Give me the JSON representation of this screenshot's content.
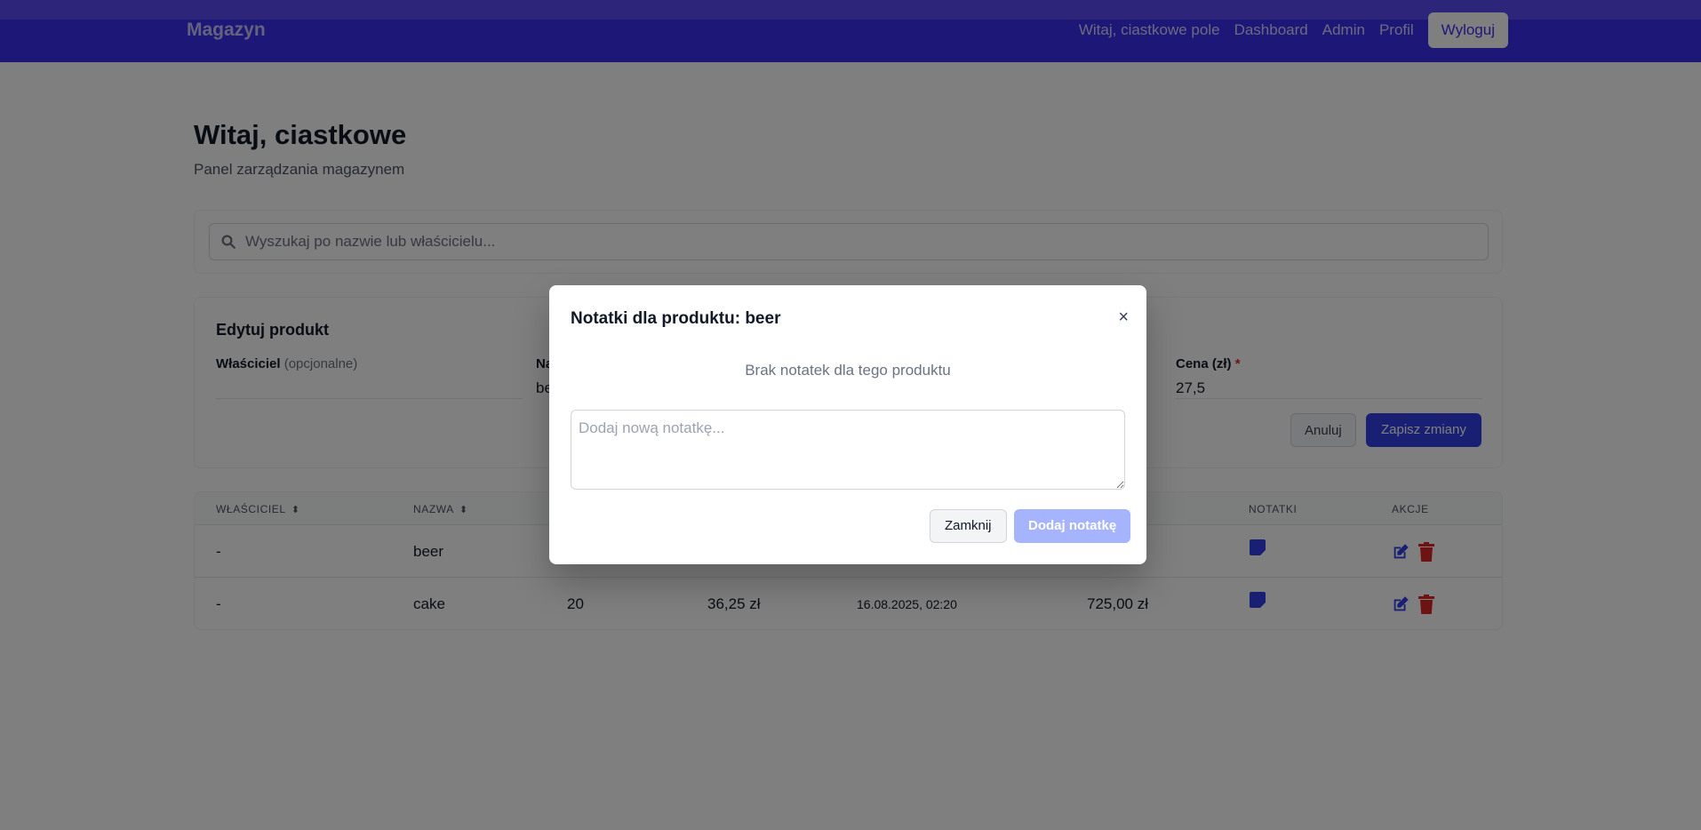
{
  "nav": {
    "brand": "Magazyn",
    "links": [
      "Witaj, ciastkowe pole",
      "Dashboard",
      "Admin",
      "Profil"
    ],
    "logout_label": "Wyloguj"
  },
  "hero": {
    "title": "Witaj, ciastkowe",
    "subtitle": "Panel zarządzania magazynem"
  },
  "search": {
    "placeholder": "Wyszukaj po nazwie lub właścicielu...",
    "value": ""
  },
  "edit_form": {
    "title": "Edytuj produkt",
    "owner_label": "Właściciel",
    "owner_optional": "(opcjonalne)",
    "owner_value": "",
    "name_label_partial": "Na",
    "name_value_partial": "be",
    "price_label": "Cena (zł)",
    "price_required": "*",
    "price_value": "27,5",
    "cancel_label": "Anuluj",
    "save_label": "Zapisz zmiany"
  },
  "table": {
    "headers": {
      "owner": "Właściciel",
      "name": "Nazwa",
      "notes": "Notatki",
      "actions": "Akcje"
    },
    "rows": [
      {
        "owner": "-",
        "name": "beer",
        "quantity": "",
        "price": "",
        "date": "",
        "total": ""
      },
      {
        "owner": "-",
        "name": "cake",
        "quantity": "20",
        "price": "36,25 zł",
        "date": "16.08.2025, 02:20",
        "total": "725,00 zł"
      }
    ]
  },
  "modal": {
    "title": "Notatki dla produktu: beer",
    "close_symbol": "×",
    "empty_text": "Brak notatek dla tego produktu",
    "textarea_placeholder": "Dodaj nową notatkę...",
    "close_label": "Zamknij",
    "add_label": "Dodaj notatkę"
  },
  "colors": {
    "nav_bg": "#3b2ff0",
    "primary": "#3340e8",
    "primary_disabled": "#a5b4fc",
    "danger": "#dc2626",
    "overlay": "rgba(0,0,0,0.5)"
  }
}
